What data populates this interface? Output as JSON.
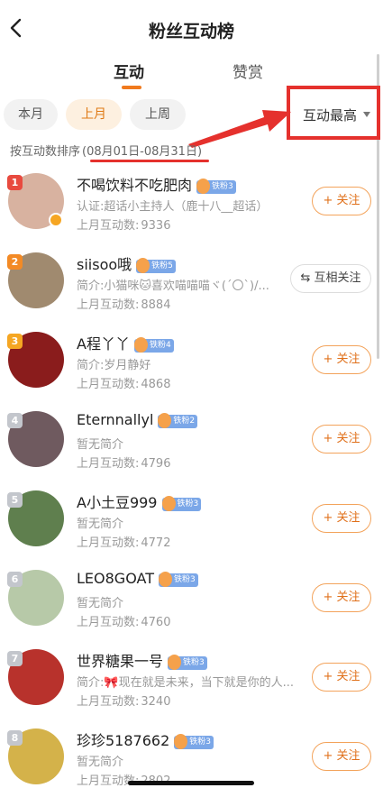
{
  "header": {
    "title": "粉丝互动榜"
  },
  "tabs": [
    {
      "label": "互动"
    },
    {
      "label": "赞赏"
    }
  ],
  "filters": [
    {
      "label": "本月"
    },
    {
      "label": "上月"
    },
    {
      "label": "上周"
    }
  ],
  "sort": {
    "label": "互动最高",
    "icon": "triangle-down-icon"
  },
  "sort_info": {
    "prefix": "按互动数排序",
    "range": "(08月01日-08月31日)"
  },
  "count_label": "上月互动数:",
  "fans": [
    {
      "rank": "1",
      "rank_color": "#e84a3f",
      "name": "不喝饮料不吃肥肉",
      "badge": "铁粉3",
      "desc": "认证:超话小主持人（鹿十八__超话）",
      "count": "9336",
      "action": "+ 关注",
      "avatar_color": "#d8b2a0",
      "verified": true
    },
    {
      "rank": "2",
      "rank_color": "#f38a25",
      "name": "siisoo哦",
      "badge": "铁粉5",
      "desc": "简介:小猫咪🐱喜欢喵喵喵ヾ(´〇`)/...",
      "count": "8884",
      "action": "⇆ 互相关注",
      "avatar_color": "#a08a6f",
      "verified": false
    },
    {
      "rank": "3",
      "rank_color": "#f5a623",
      "name": "A程丫丫",
      "badge": "铁粉4",
      "desc": "简介:岁月静好",
      "count": "4868",
      "action": "+ 关注",
      "avatar_color": "#8a1c1c",
      "verified": false
    },
    {
      "rank": "4",
      "rank_color": "#c3c6cc",
      "name": "Eternnallyl",
      "badge": "铁粉2",
      "desc": "暂无简介",
      "count": "4796",
      "action": "+ 关注",
      "avatar_color": "#6f5a5f",
      "verified": false
    },
    {
      "rank": "5",
      "rank_color": "#c3c6cc",
      "name": "A小土豆999",
      "badge": "铁粉3",
      "desc": "暂无简介",
      "count": "4772",
      "action": "+ 关注",
      "avatar_color": "#5f7f4e",
      "verified": false
    },
    {
      "rank": "6",
      "rank_color": "#c3c6cc",
      "name": "LEO8GOAT",
      "badge": "铁粉3",
      "desc": "暂无简介",
      "count": "4760",
      "action": "+ 关注",
      "avatar_color": "#b7c9a8",
      "verified": false
    },
    {
      "rank": "7",
      "rank_color": "#c3c6cc",
      "name": "世界糖果一号",
      "badge": "铁粉3",
      "desc": "简介:🎀现在就是未来，当下就是你的人...",
      "count": "3240",
      "action": "+ 关注",
      "avatar_color": "#b8322c",
      "verified": false
    },
    {
      "rank": "8",
      "rank_color": "#c3c6cc",
      "name": "珍珍5187662",
      "badge": "铁粉3",
      "desc": "暂无简介",
      "count": "2802",
      "action": "+ 关注",
      "avatar_color": "#d4b24a",
      "verified": false
    }
  ]
}
